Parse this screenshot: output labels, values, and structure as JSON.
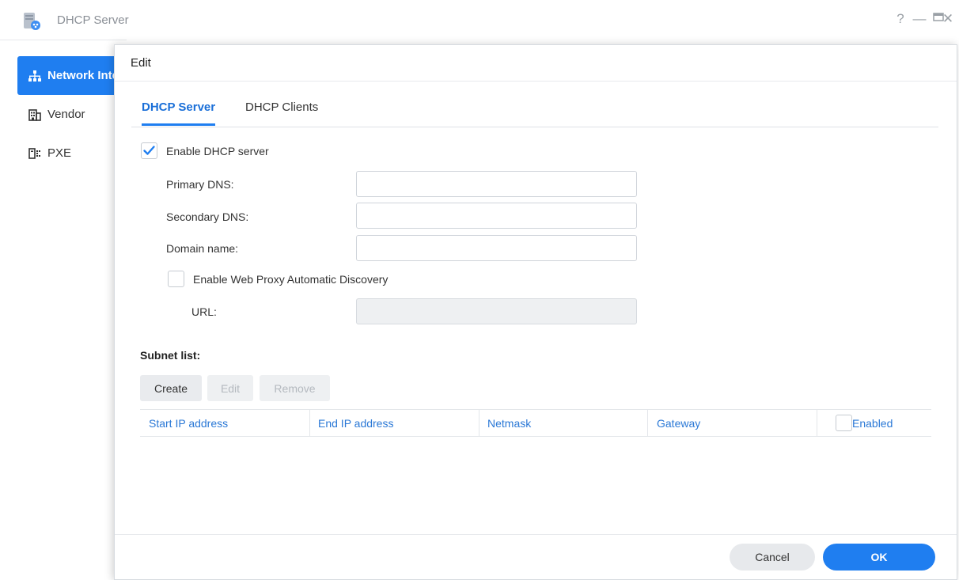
{
  "window": {
    "title": "DHCP Server",
    "controls": {
      "help": "?",
      "minimize": "—",
      "maximize": "▭",
      "close": "✕"
    }
  },
  "sidebar": {
    "items": [
      {
        "label": "Network Interface",
        "icon": "network-icon",
        "active": true
      },
      {
        "label": "Vendor",
        "icon": "building-icon",
        "active": false
      },
      {
        "label": "PXE",
        "icon": "pxe-icon",
        "active": false
      }
    ]
  },
  "modal": {
    "title": "Edit",
    "tabs": [
      {
        "label": "DHCP Server",
        "active": true
      },
      {
        "label": "DHCP Clients",
        "active": false
      }
    ],
    "enable_dhcp": {
      "label": "Enable DHCP server",
      "checked": true
    },
    "primary_dns": {
      "label": "Primary DNS:",
      "value": ""
    },
    "secondary_dns": {
      "label": "Secondary DNS:",
      "value": ""
    },
    "domain_name": {
      "label": "Domain name:",
      "value": ""
    },
    "wpad": {
      "label": "Enable Web Proxy Automatic Discovery",
      "checked": false
    },
    "url": {
      "label": "URL:",
      "value": "",
      "disabled": true
    },
    "subnet": {
      "title": "Subnet list:",
      "buttons": {
        "create": "Create",
        "edit": "Edit",
        "remove": "Remove"
      },
      "columns": [
        "Start IP address",
        "End IP address",
        "Netmask",
        "Gateway",
        "Enabled"
      ],
      "rows": []
    },
    "footer": {
      "cancel": "Cancel",
      "ok": "OK"
    }
  },
  "colors": {
    "accent": "#1f7ef0",
    "header_text": "#2a78d6"
  }
}
